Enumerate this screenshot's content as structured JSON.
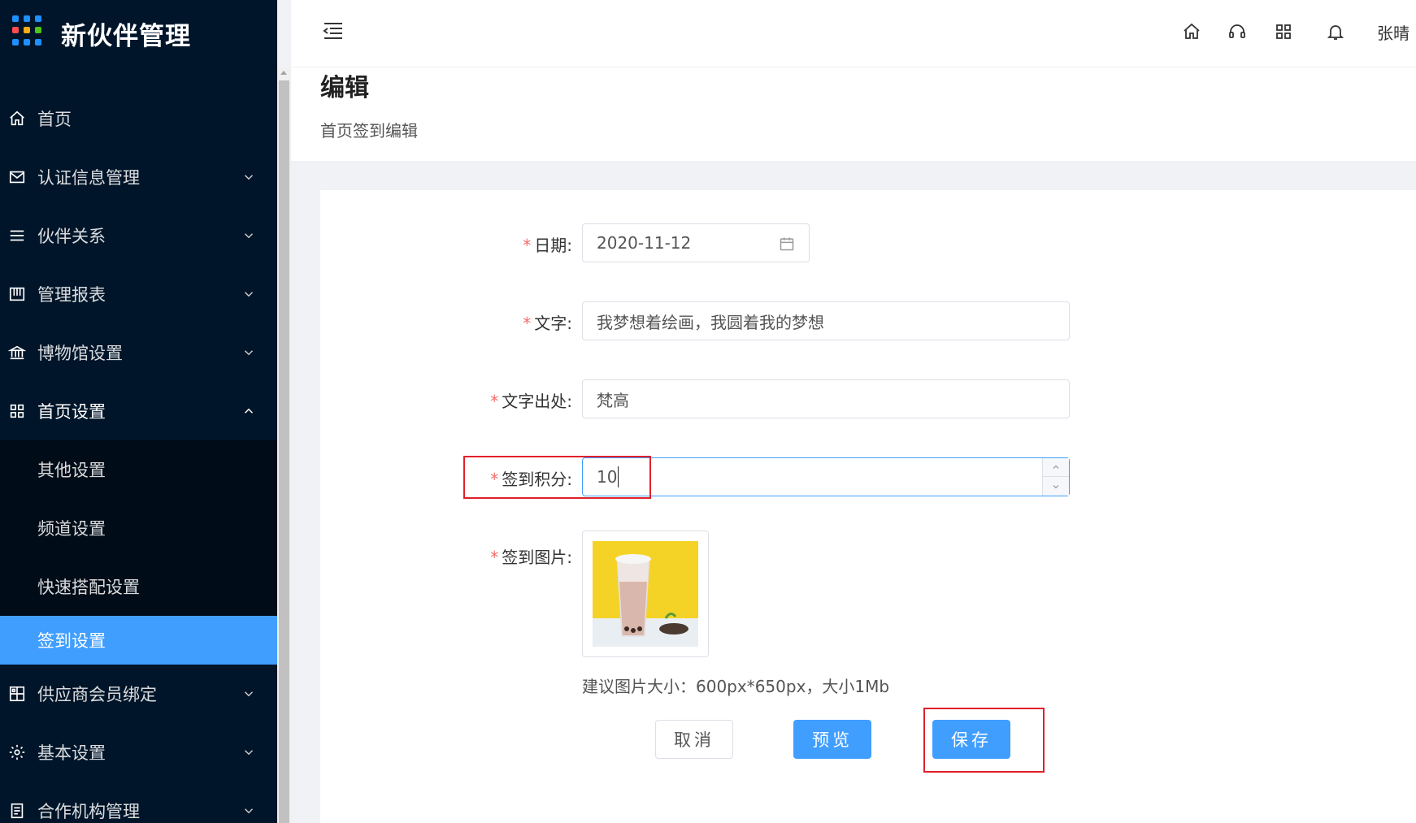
{
  "app": {
    "title": "新伙伴管理"
  },
  "sidebar": {
    "items": [
      {
        "label": "首页",
        "icon": "home-icon",
        "expandable": false
      },
      {
        "label": "认证信息管理",
        "icon": "mail-icon",
        "expandable": true
      },
      {
        "label": "伙伴关系",
        "icon": "list-icon",
        "expandable": true
      },
      {
        "label": "管理报表",
        "icon": "report-icon",
        "expandable": true
      },
      {
        "label": "博物馆设置",
        "icon": "museum-icon",
        "expandable": true
      },
      {
        "label": "首页设置",
        "icon": "grid-icon",
        "expandable": true,
        "expanded": true
      },
      {
        "label": "供应商会员绑定",
        "icon": "apps-icon",
        "expandable": true
      },
      {
        "label": "基本设置",
        "icon": "gear-icon",
        "expandable": true
      },
      {
        "label": "合作机构管理",
        "icon": "doc-icon",
        "expandable": true
      }
    ],
    "submenu": [
      {
        "label": "其他设置"
      },
      {
        "label": "频道设置"
      },
      {
        "label": "快速搭配设置"
      },
      {
        "label": "签到设置",
        "active": true
      }
    ]
  },
  "header": {
    "user": "张晴",
    "icons": [
      "home-icon",
      "headset-icon",
      "apps-icon",
      "bell-icon"
    ]
  },
  "page": {
    "title": "编辑",
    "subtitle": "首页签到编辑"
  },
  "form": {
    "date": {
      "label": "日期:",
      "value": "2020-11-12"
    },
    "text": {
      "label": "文字:",
      "value": "我梦想着绘画，我圆着我的梦想"
    },
    "source": {
      "label": "文字出处:",
      "value": "梵高"
    },
    "points": {
      "label": "签到积分:",
      "value": "10"
    },
    "image": {
      "label": "签到图片:",
      "hint": "建议图片大小：600px*650px，大小1Mb"
    }
  },
  "buttons": {
    "cancel": "取消",
    "preview": "预览",
    "save": "保存"
  },
  "colors": {
    "sidebar_bg": "#001529",
    "submenu_bg": "#000c17",
    "accent": "#409eff",
    "required": "#f56c6c",
    "highlight": "#e0202a"
  }
}
